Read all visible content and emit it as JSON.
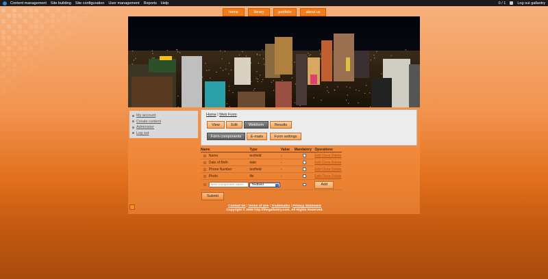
{
  "admin_bar": {
    "menu": [
      "Content management",
      "Site building",
      "Site configuration",
      "User management",
      "Reports",
      "Help"
    ],
    "counter": "0 / 1",
    "logout": "Log out gallantry"
  },
  "top_nav": {
    "tabs": [
      "home",
      "library",
      "portfolio",
      "about us"
    ]
  },
  "user_menu": {
    "items": [
      "My account",
      "Create content",
      "Administer",
      "Log out"
    ]
  },
  "breadcrumb": {
    "home": "Home",
    "separator": "|",
    "current": "Web Form"
  },
  "tabs_primary": [
    "View",
    "Edit",
    "Webform",
    "Results"
  ],
  "tabs_secondary": [
    "Form components",
    "E-mails",
    "Form settings"
  ],
  "components_table": {
    "headers": [
      "Name",
      "Type",
      "Value",
      "Mandatory",
      "Operations"
    ],
    "rows": [
      {
        "name": "Name",
        "type": "textfield",
        "value": "-",
        "ops": "Edit Clone Delete"
      },
      {
        "name": "Date of Birth",
        "type": "date",
        "value": "-",
        "ops": "Edit Clone Delete"
      },
      {
        "name": "Phone Number",
        "type": "textfield",
        "value": "-",
        "ops": "Edit Clone Delete"
      },
      {
        "name": "Photo",
        "type": "file",
        "value": "-",
        "ops": "Edit Clone Delete"
      }
    ],
    "new_row": {
      "placeholder": "New component name",
      "type_selected": "Textfield",
      "add_label": "Add"
    }
  },
  "submit_label": "Submit",
  "footer": {
    "links": [
      "Contact Us",
      "Terms of Use",
      "Trademarks",
      "Privacy Statement"
    ],
    "copyright": "Copyright © 2009 http://thegallantry.com. All Rights Reserved."
  },
  "colors": {
    "accent": "#f07d1c",
    "active_tab": "#5c5c5c",
    "admin_bar": "#1b1b1b"
  },
  "icons": {
    "feed": "rss-feed-icon"
  }
}
